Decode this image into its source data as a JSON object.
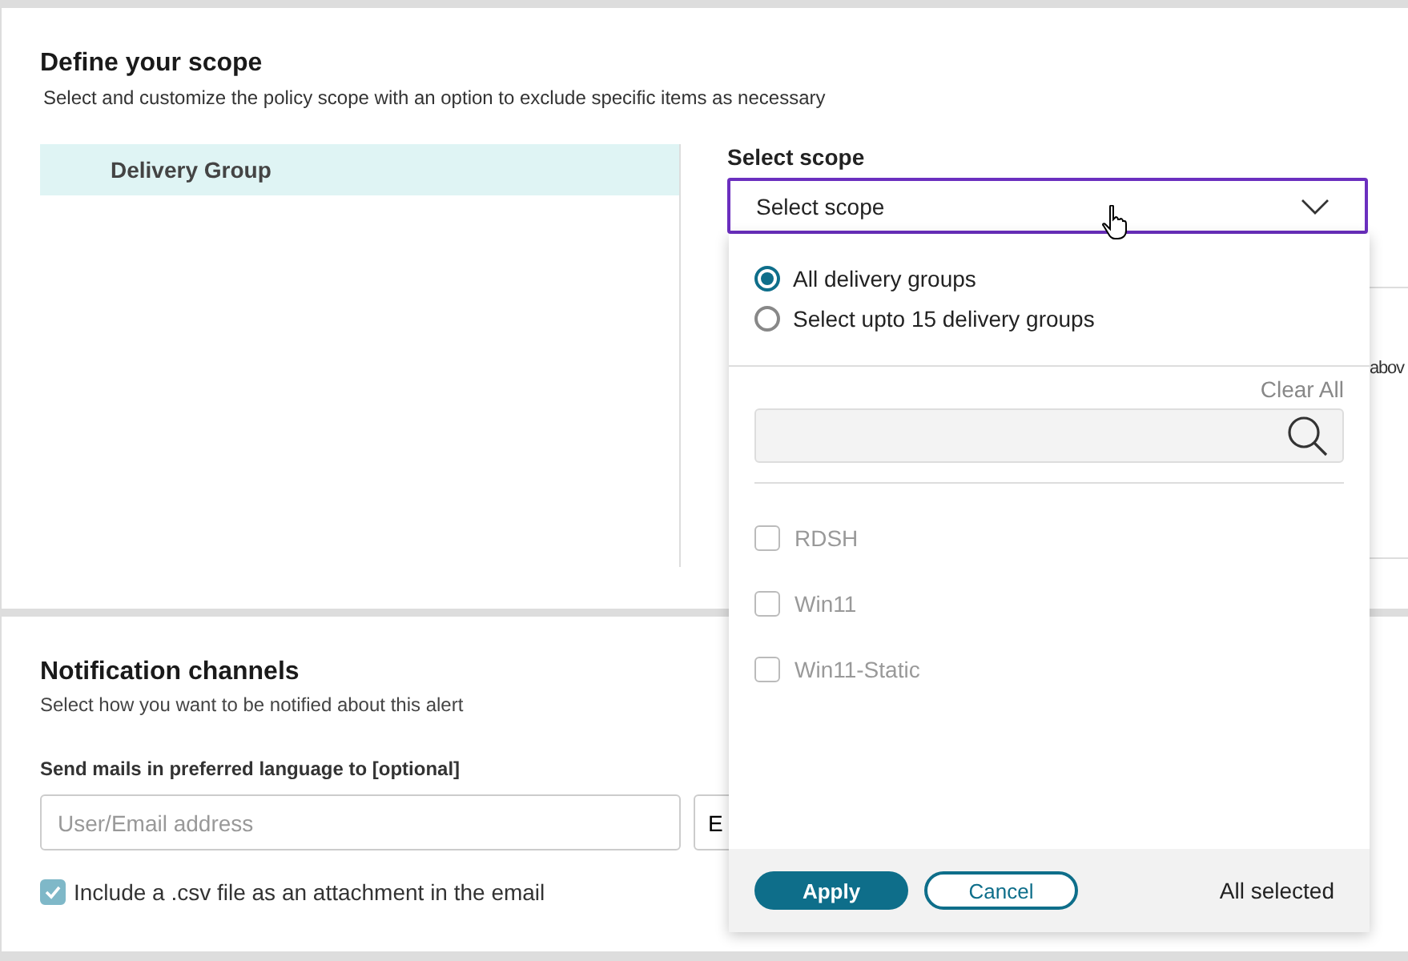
{
  "scope_section": {
    "title": "Define your scope",
    "subtitle": "Select and customize the policy scope with an option to exclude specific items as necessary",
    "categories": [
      {
        "label": "Delivery Group",
        "selected": true
      }
    ],
    "select_label": "Select scope",
    "select": {
      "placeholder": "Select scope",
      "expanded": true
    },
    "behind_panel_text": "abov",
    "dropdown": {
      "options": [
        {
          "label": "All delivery groups",
          "selected": true
        },
        {
          "label": "Select upto 15 delivery groups",
          "selected": false
        }
      ],
      "clear_all": "Clear All",
      "items": [
        {
          "label": "RDSH",
          "checked": false,
          "disabled": true
        },
        {
          "label": "Win11",
          "checked": false,
          "disabled": true
        },
        {
          "label": "Win11-Static",
          "checked": false,
          "disabled": true
        }
      ],
      "apply": "Apply",
      "cancel": "Cancel",
      "status": "All selected"
    }
  },
  "notification_section": {
    "title": "Notification channels",
    "subtitle": "Select how you want to be notified about this alert",
    "email_label": "Send mails in preferred language to [optional]",
    "email": {
      "placeholder": "User/Email address"
    },
    "email_button": "E",
    "csv": {
      "label": "Include a .csv file as an attachment in the email",
      "checked": true
    }
  }
}
